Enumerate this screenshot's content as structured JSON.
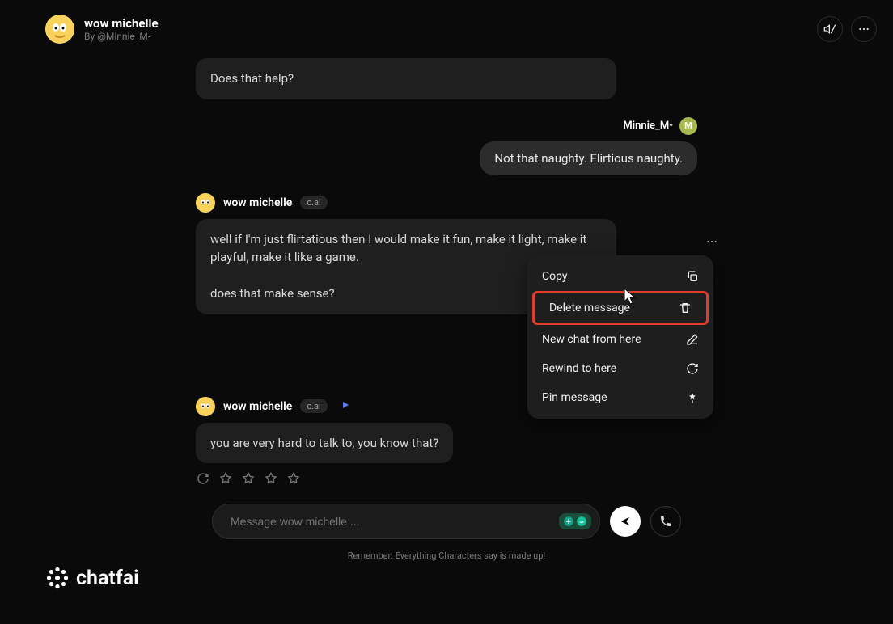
{
  "header": {
    "char_name": "wow michelle",
    "byline": "By @Minnie_M-"
  },
  "user": {
    "label": "Minnie_M-",
    "initial": "M"
  },
  "messages": {
    "m0": "Does that help?",
    "m1": "Not that naughty. Flirtious naughty.",
    "m2_l1": "well if I'm just flirtatious then I would make it fun, make it light, make it playful, make it like a game.",
    "m2_l2": "does that make sense?",
    "m4": "you are very hard to talk to, you know that?"
  },
  "badge": "c.ai",
  "ctx": {
    "copy": "Copy",
    "delete": "Delete message",
    "newchat": "New chat from here",
    "rewind": "Rewind to here",
    "pin": "Pin message"
  },
  "input": {
    "placeholder": "Message wow michelle ..."
  },
  "disclaimer": "Remember: Everything Characters say is made up!",
  "brand": "chatfai"
}
